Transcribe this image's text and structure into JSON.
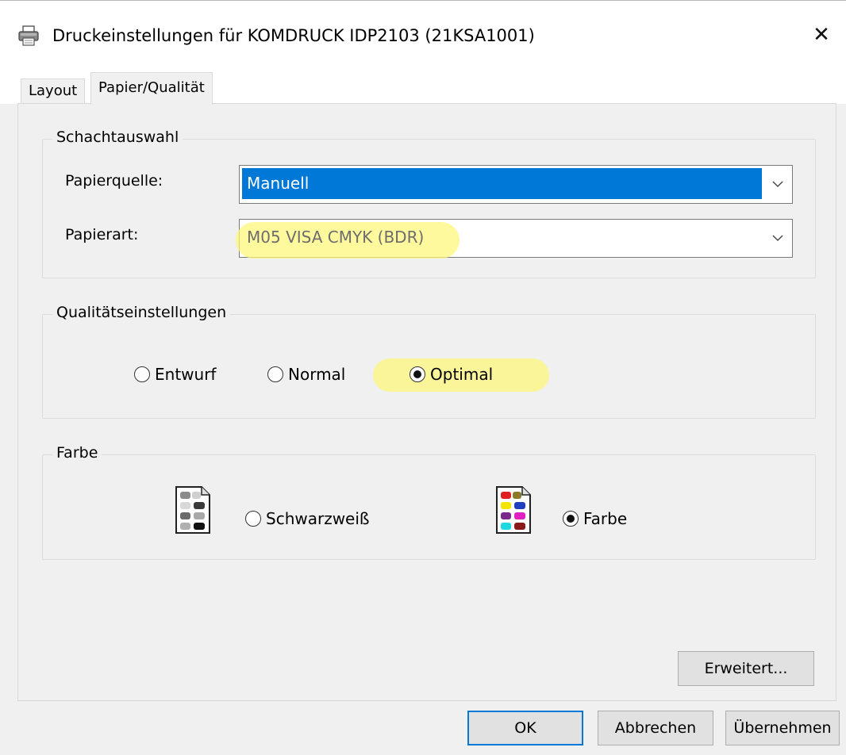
{
  "window": {
    "title": "Druckeinstellungen für KOMDRUCK IDP2103 (21KSA1001)",
    "close_glyph": "✕"
  },
  "tabs": [
    {
      "label": "Layout",
      "active": false
    },
    {
      "label": "Papier/Qualität",
      "active": true
    }
  ],
  "schachtauswahl": {
    "title": "Schachtauswahl",
    "papierquelle_label": "Papierquelle:",
    "papierquelle_value": "Manuell",
    "papierart_label": "Papierart:",
    "papierart_value": "M05 VISA CMYK (BDR)"
  },
  "qualitaet": {
    "title": "Qualitätseinstellungen",
    "options": [
      {
        "label": "Entwurf",
        "selected": false
      },
      {
        "label": "Normal",
        "selected": false
      },
      {
        "label": "Optimal",
        "selected": true
      }
    ]
  },
  "farbe": {
    "title": "Farbe",
    "options": [
      {
        "label": "Schwarzweiß",
        "selected": false,
        "icon": "grayscale-paper-icon"
      },
      {
        "label": "Farbe",
        "selected": true,
        "icon": "color-paper-icon"
      }
    ]
  },
  "buttons": {
    "advanced": "Erweitert...",
    "ok": "OK",
    "cancel": "Abbrechen",
    "apply": "Übernehmen"
  },
  "colors": {
    "selection_blue": "#0078d7",
    "highlight_yellow": "#fff678",
    "dialog_bg": "#f0f0f0"
  }
}
